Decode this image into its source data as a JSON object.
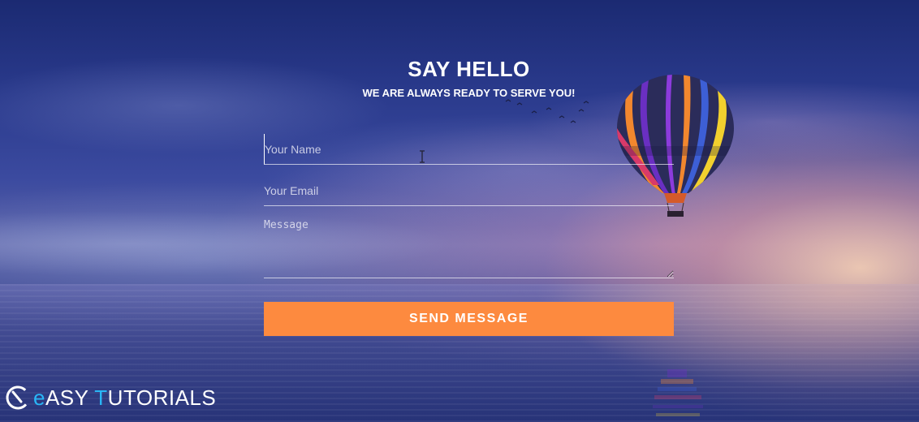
{
  "page": {
    "title": "SAY HELLO",
    "subtitle": "WE ARE ALWAYS READY TO SERVE YOU!"
  },
  "form": {
    "name_placeholder": "Your Name",
    "name_value": "",
    "email_placeholder": "Your Email",
    "email_value": "",
    "message_placeholder": "Message",
    "message_value": "",
    "submit_label": "SEND MESSAGE",
    "submit_color": "#fd8a3f"
  },
  "brand": {
    "logo_icon": "easy-tutorials-logo-icon",
    "name_accent_1": "e",
    "name_part_1": "ASY ",
    "name_accent_2": "T",
    "name_part_2": "UTORIALS",
    "accent_color": "#29b6f6"
  }
}
